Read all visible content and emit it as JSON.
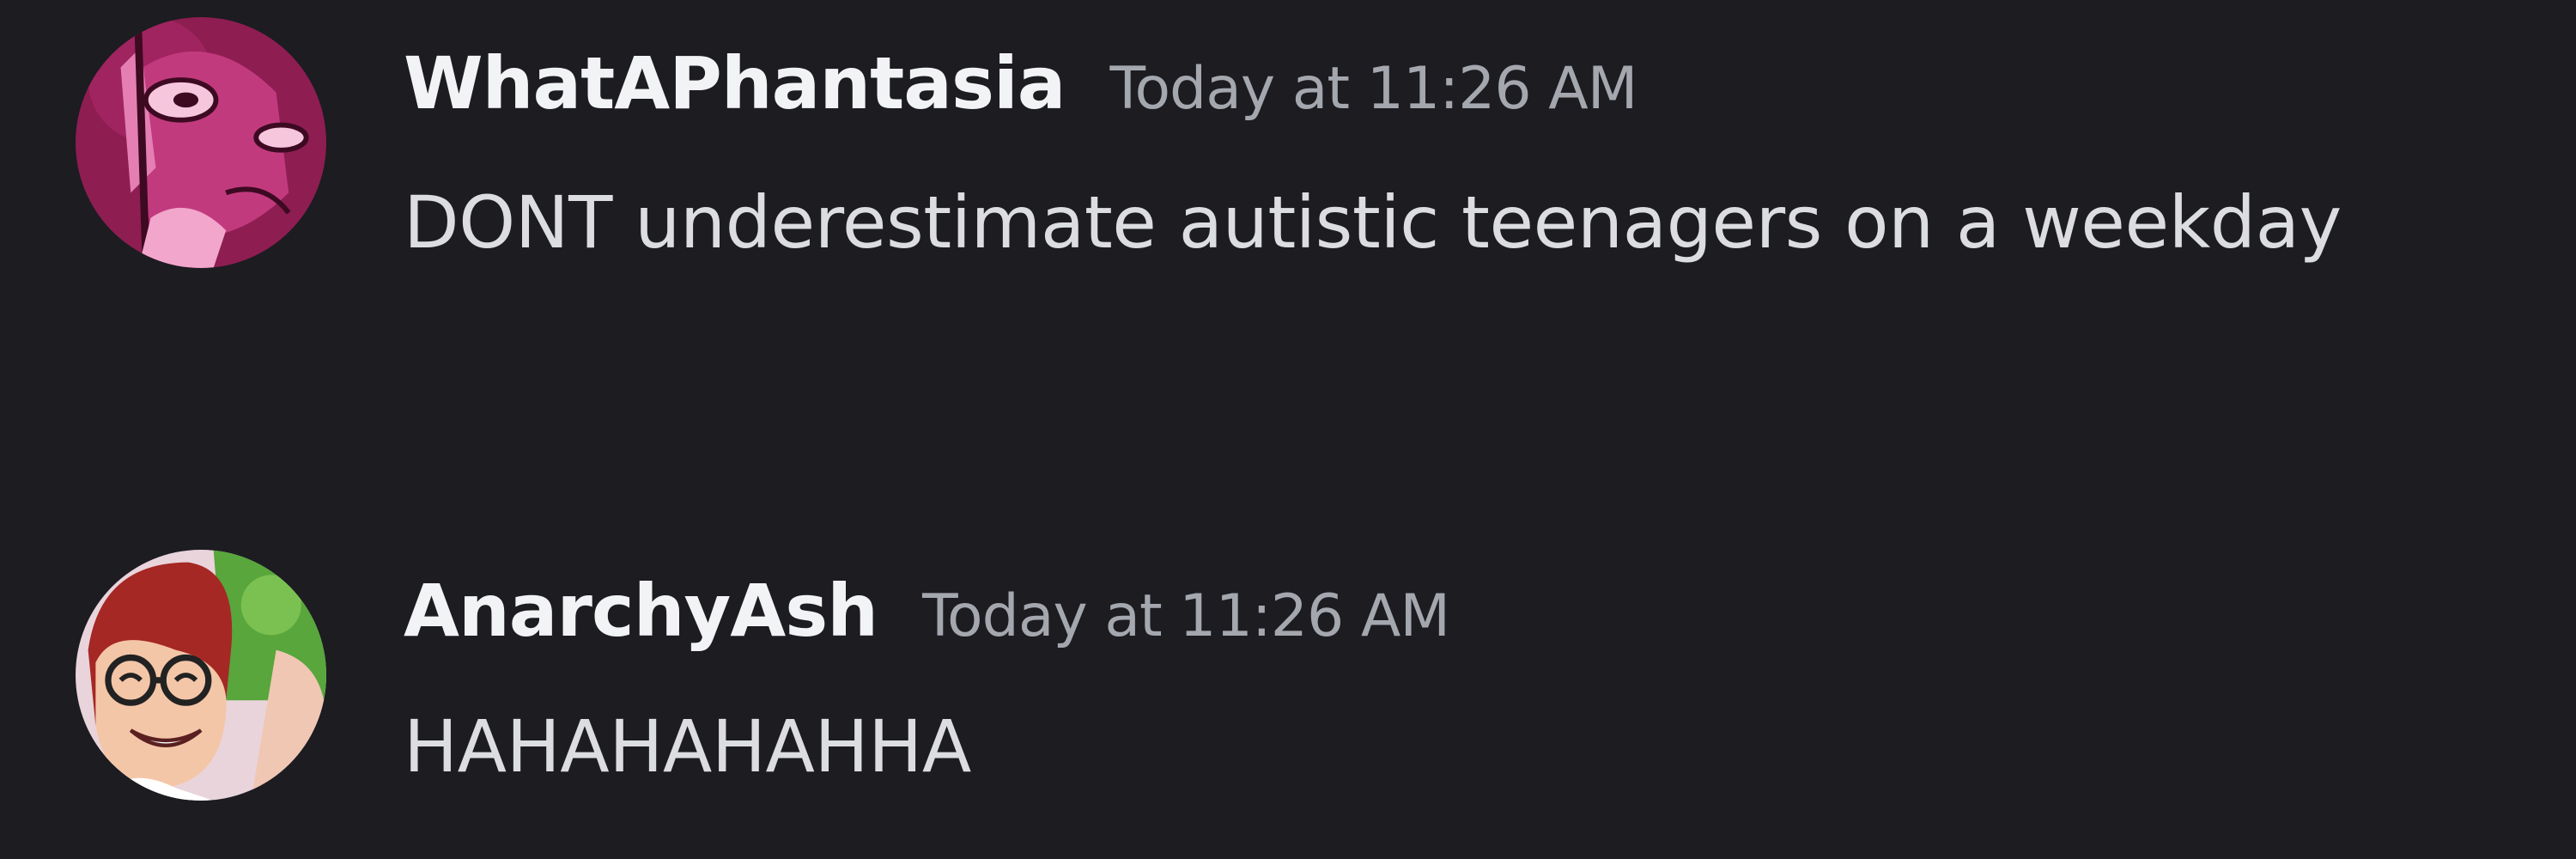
{
  "messages": [
    {
      "username": "WhatAPhantasia",
      "timestamp": "Today at 11:26 AM",
      "content": "DONT underestimate autistic teenagers on a weekday",
      "avatar_icon": "pink-character-avatar-icon"
    },
    {
      "username": "AnarchyAsh",
      "timestamp": "Today at 11:26 AM",
      "content": "HAHAHAHAHHA",
      "avatar_icon": "red-haired-glasses-character-avatar-icon"
    }
  ],
  "colors": {
    "background": "#1c1c21",
    "username": "#f2f3f5",
    "timestamp": "#a5a7af",
    "message_text": "#dcdde1"
  }
}
